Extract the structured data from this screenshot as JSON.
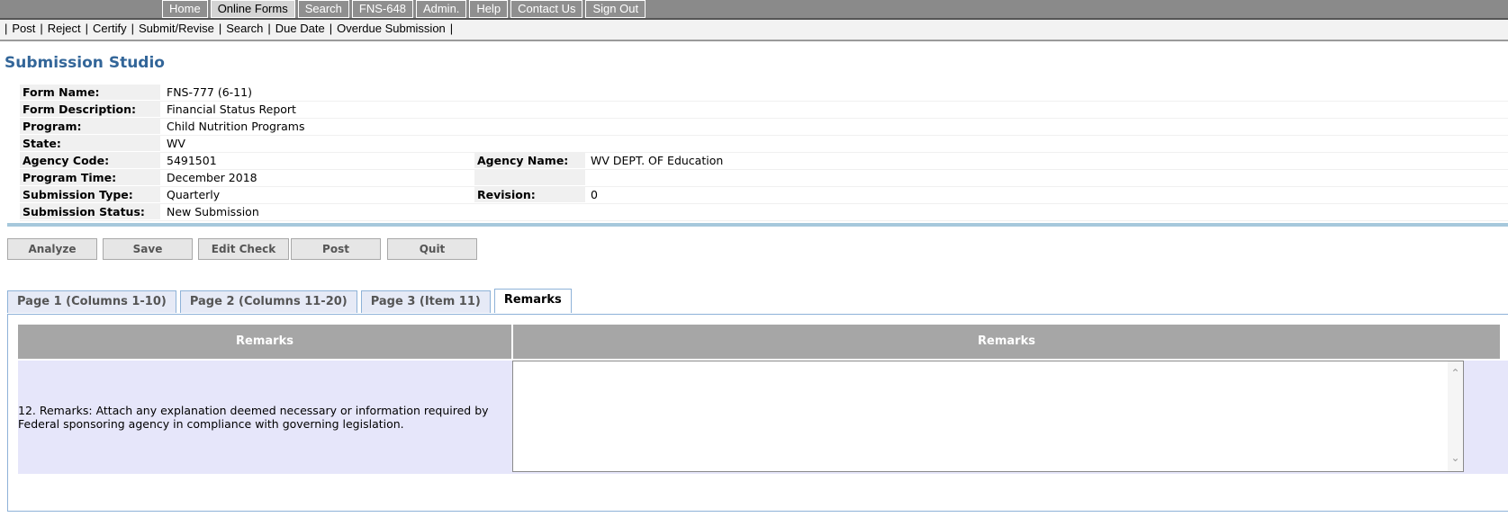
{
  "topnav": {
    "items": [
      {
        "label": "Home",
        "active": false
      },
      {
        "label": "Online Forms",
        "active": true
      },
      {
        "label": "Search",
        "active": false
      },
      {
        "label": "FNS-648",
        "active": false
      },
      {
        "label": "Admin.",
        "active": false
      },
      {
        "label": "Help",
        "active": false
      },
      {
        "label": "Contact Us",
        "active": false
      },
      {
        "label": "Sign Out",
        "active": false
      }
    ]
  },
  "subnav": {
    "separator": "|",
    "items": [
      "Post",
      "Reject",
      "Certify",
      "Submit/Revise",
      "Search",
      "Due Date",
      "Overdue Submission"
    ]
  },
  "page_title": "Submission Studio",
  "info": {
    "form_name_label": "Form Name:",
    "form_name": "FNS-777 (6-11)",
    "form_description_label": "Form Description:",
    "form_description": "Financial Status Report",
    "program_label": "Program:",
    "program": "Child Nutrition Programs",
    "state_label": "State:",
    "state": "WV",
    "agency_code_label": "Agency Code:",
    "agency_code": "5491501",
    "agency_name_label": "Agency Name:",
    "agency_name": "WV DEPT. OF Education",
    "program_time_label": "Program Time:",
    "program_time": "December 2018",
    "submission_type_label": "Submission Type:",
    "submission_type": "Quarterly",
    "revision_label": "Revision:",
    "revision": "0",
    "submission_status_label": "Submission Status:",
    "submission_status": "New Submission"
  },
  "actions": {
    "analyze": "Analyze",
    "save": "Save",
    "edit_check": "Edit Check",
    "post": "Post",
    "quit": "Quit"
  },
  "tabs": [
    {
      "label": "Page 1 (Columns 1-10)",
      "active": false
    },
    {
      "label": "Page 2 (Columns 11-20)",
      "active": false
    },
    {
      "label": "Page 3 (Item 11)",
      "active": false
    },
    {
      "label": "Remarks",
      "active": true
    }
  ],
  "remarks": {
    "col1_header": "Remarks",
    "col2_header": "Remarks",
    "item_label": "12. Remarks: Attach any explanation deemed necessary or information required by Federal sponsoring agency in compliance with governing legislation.",
    "value": ""
  },
  "colors": {
    "title": "#336699",
    "accent_bar": "#a6c8dc",
    "header_gray": "#a6a6a6",
    "row_lavender": "#e6e6fa"
  }
}
